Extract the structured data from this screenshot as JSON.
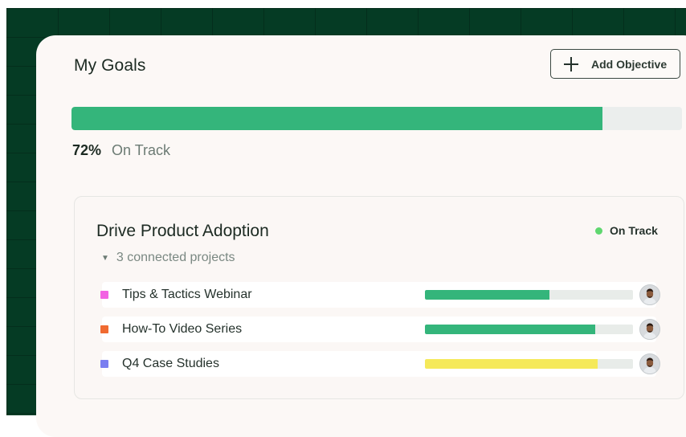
{
  "page": {
    "title": "My Goals",
    "add_button": {
      "label": "Add Objective",
      "icon": "plus-icon"
    }
  },
  "overall": {
    "progress_percent": 87,
    "label_percent": "72%",
    "status": "On Track",
    "fill_color": "#34b57b"
  },
  "objective": {
    "title": "Drive Product Adoption",
    "status": "On Track",
    "status_color": "#5fd76f",
    "connected_label": "3 connected projects",
    "toggle_icon": "caret-down-icon",
    "projects": [
      {
        "name": "Tips & Tactics Webinar",
        "color": "#f263e3",
        "progress": 0.6,
        "bar_color": "#34b57b",
        "avatar": "user-avatar"
      },
      {
        "name": "How-To Video Series",
        "color": "#f06a30",
        "progress": 0.82,
        "bar_color": "#34b57b",
        "avatar": "user-avatar"
      },
      {
        "name": "Q4 Case Studies",
        "color": "#7a7ef0",
        "progress": 0.83,
        "bar_color": "#f5e95a",
        "avatar": "user-avatar"
      }
    ]
  }
}
